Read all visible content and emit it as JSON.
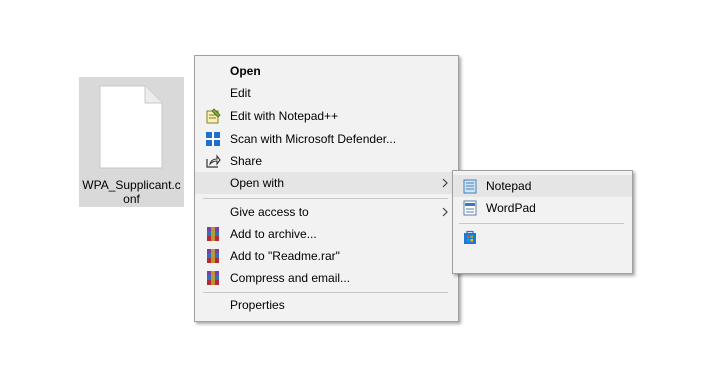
{
  "desktop": {
    "file": {
      "name": "WPA_Supplicant.conf",
      "icon": "document-icon"
    }
  },
  "context_menu": {
    "items": [
      {
        "label": "Open",
        "bold": true
      },
      {
        "label": "Edit"
      },
      {
        "label": "Edit with Notepad++",
        "icon": "notepad-plus-plus-icon"
      },
      {
        "label": "Scan with Microsoft Defender...",
        "icon": "defender-shield-icon"
      },
      {
        "label": "Share",
        "icon": "share-icon"
      },
      {
        "label": "Open with",
        "submenu": true,
        "highlighted": true
      },
      {
        "label": "Give access to",
        "submenu": true
      },
      {
        "label": "Add to archive...",
        "icon": "winrar-icon"
      },
      {
        "label": "Add to \"Readme.rar\"",
        "icon": "winrar-icon"
      },
      {
        "label": "Compress and email...",
        "icon": "winrar-icon"
      },
      {
        "label": "Properties"
      }
    ]
  },
  "open_with_submenu": {
    "items": [
      {
        "label": "Notepad",
        "icon": "notepad-icon",
        "highlighted": true
      },
      {
        "label": "WordPad",
        "icon": "wordpad-icon"
      },
      {
        "label": "",
        "icon": "microsoft-store-icon"
      }
    ]
  },
  "colors": {
    "menu_bg": "#f2f2f2",
    "highlight": "#e5e5e5",
    "file_selection": "#d9d9d9",
    "defender_blue": "#1e6fd0",
    "winrar_red": "#b02a3a"
  }
}
